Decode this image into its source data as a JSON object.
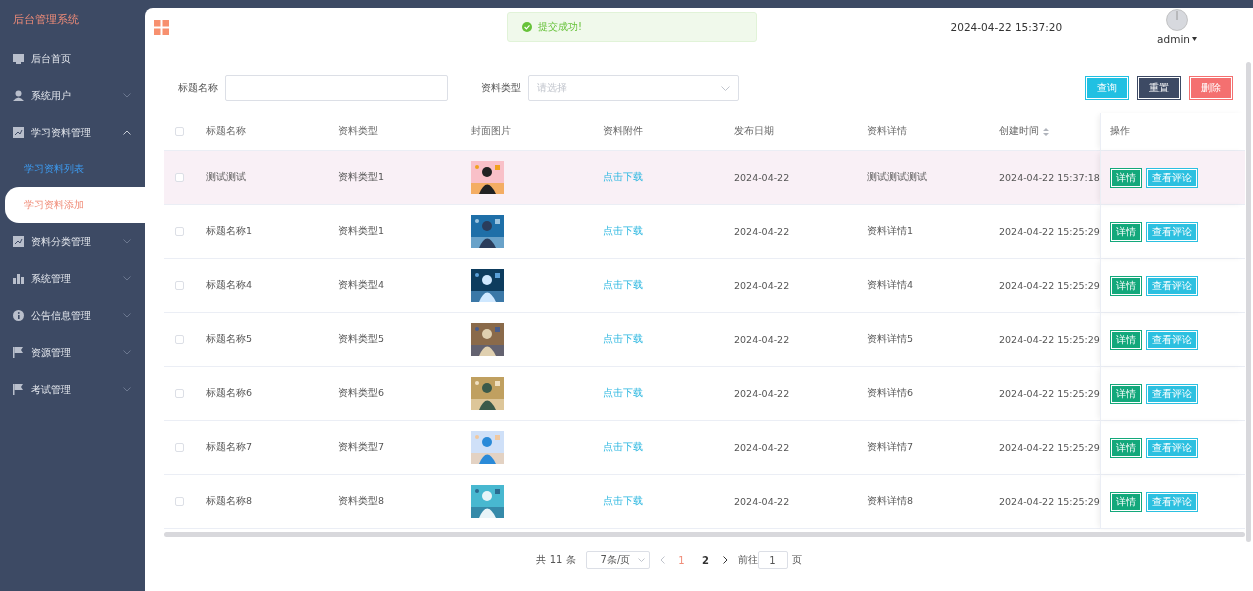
{
  "sidebar": {
    "title": "后台管理系统",
    "items": [
      {
        "label": "后台首页",
        "kind": "link"
      },
      {
        "label": "系统用户",
        "kind": "menu",
        "expanded": false
      },
      {
        "label": "学习资料管理",
        "kind": "menu",
        "expanded": true,
        "children": [
          {
            "label": "学习资料列表",
            "selected": false,
            "highlighted": true
          },
          {
            "label": "学习资料添加",
            "selected": true,
            "highlighted": false
          }
        ]
      },
      {
        "label": "资料分类管理",
        "kind": "menu",
        "expanded": false
      },
      {
        "label": "系统管理",
        "kind": "menu",
        "expanded": false
      },
      {
        "label": "公告信息管理",
        "kind": "menu",
        "expanded": false
      },
      {
        "label": "资源管理",
        "kind": "menu",
        "expanded": false
      },
      {
        "label": "考试管理",
        "kind": "menu",
        "expanded": false
      }
    ]
  },
  "header": {
    "datetime": "2024-04-22 15:37:20",
    "user": "admin"
  },
  "toast": {
    "kind": "success",
    "message": "提交成功!"
  },
  "search": {
    "fields": [
      {
        "kind": "text",
        "label": "标题名称"
      },
      {
        "kind": "select",
        "label": "资料类型",
        "placeholder": "请选择"
      }
    ],
    "buttons": [
      {
        "kind": "query",
        "label": "查询"
      },
      {
        "kind": "reset",
        "label": "重置"
      },
      {
        "kind": "delete",
        "label": "删除"
      }
    ]
  },
  "table": {
    "select_all": {
      "checked": false
    },
    "columns": [
      {
        "label": "标题名称"
      },
      {
        "label": "资料类型"
      },
      {
        "label": "封面图片"
      },
      {
        "label": "资料附件"
      },
      {
        "label": "发布日期"
      },
      {
        "label": "资料详情"
      },
      {
        "label": "创建时间",
        "sortable": true
      },
      {
        "label": "操作"
      }
    ],
    "rows": [
      {
        "checked": false,
        "highlighted": true,
        "title": "测试测试",
        "type": "资料类型1",
        "cover": {
          "kind": "picture"
        },
        "attachment": "点击下载",
        "date": "2024-04-22",
        "detail": "测试测试测试",
        "created": "2024-04-22 15:37:18",
        "actions": [
          "详情",
          "查看评论"
        ]
      },
      {
        "checked": false,
        "highlighted": false,
        "title": "标题名称1",
        "type": "资料类型1",
        "cover": {
          "kind": "picture"
        },
        "attachment": "点击下载",
        "date": "2024-04-22",
        "detail": "资料详情1",
        "created": "2024-04-22 15:25:29",
        "actions": [
          "详情",
          "查看评论"
        ]
      },
      {
        "checked": false,
        "highlighted": false,
        "title": "标题名称4",
        "type": "资料类型4",
        "cover": {
          "kind": "picture"
        },
        "attachment": "点击下载",
        "date": "2024-04-22",
        "detail": "资料详情4",
        "created": "2024-04-22 15:25:29",
        "actions": [
          "详情",
          "查看评论"
        ]
      },
      {
        "checked": false,
        "highlighted": false,
        "title": "标题名称5",
        "type": "资料类型5",
        "cover": {
          "kind": "picture"
        },
        "attachment": "点击下载",
        "date": "2024-04-22",
        "detail": "资料详情5",
        "created": "2024-04-22 15:25:29",
        "actions": [
          "详情",
          "查看评论"
        ]
      },
      {
        "checked": false,
        "highlighted": false,
        "title": "标题名称6",
        "type": "资料类型6",
        "cover": {
          "kind": "picture"
        },
        "attachment": "点击下载",
        "date": "2024-04-22",
        "detail": "资料详情6",
        "created": "2024-04-22 15:25:29",
        "actions": [
          "详情",
          "查看评论"
        ]
      },
      {
        "checked": false,
        "highlighted": false,
        "title": "标题名称7",
        "type": "资料类型7",
        "cover": {
          "kind": "picture"
        },
        "attachment": "点击下载",
        "date": "2024-04-22",
        "detail": "资料详情7",
        "created": "2024-04-22 15:25:29",
        "actions": [
          "详情",
          "查看评论"
        ]
      },
      {
        "checked": false,
        "highlighted": false,
        "title": "标题名称8",
        "type": "资料类型8",
        "cover": {
          "kind": "picture"
        },
        "attachment": "点击下载",
        "date": "2024-04-22",
        "detail": "资料详情8",
        "created": "2024-04-22 15:25:29",
        "actions": [
          "详情",
          "查看评论"
        ]
      }
    ]
  },
  "pagination": {
    "total": "共 11 条",
    "page_size": "7条/页",
    "pages": [
      {
        "label": "1",
        "selected": true
      },
      {
        "label": "2",
        "selected": false
      }
    ],
    "goto_label": "前往",
    "goto_value": "1",
    "goto_suffix": "页"
  }
}
